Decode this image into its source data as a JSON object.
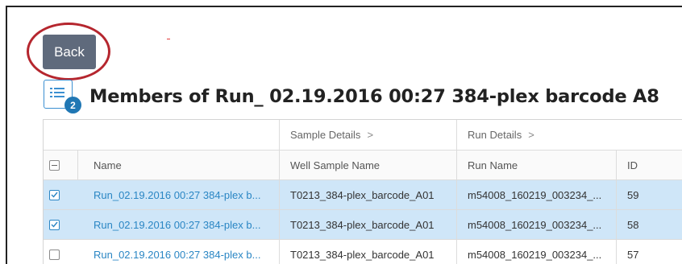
{
  "back_button": {
    "label": "Back"
  },
  "list_button": {
    "icon": "list-icon",
    "badge_count": "2"
  },
  "page_title": "Members of Run_ 02.19.2016 00:27 384-plex barcode A8",
  "table": {
    "column_groups": [
      {
        "label": "Sample Details",
        "chevron": ">"
      },
      {
        "label": "Run Details",
        "chevron": ">"
      }
    ],
    "columns": {
      "name": "Name",
      "well_sample_name": "Well Sample Name",
      "run_name": "Run Name",
      "id": "ID"
    },
    "rows": [
      {
        "selected": true,
        "name": "Run_02.19.2016 00:27 384-plex b...",
        "well_sample_name": "T0213_384-plex_barcode_A01",
        "run_name": "m54008_160219_003234_...",
        "id": "59"
      },
      {
        "selected": true,
        "name": "Run_02.19.2016 00:27 384-plex b...",
        "well_sample_name": "T0213_384-plex_barcode_A01",
        "run_name": "m54008_160219_003234_...",
        "id": "58"
      },
      {
        "selected": false,
        "name": "Run_02.19.2016 00:27 384-plex b...",
        "well_sample_name": "T0213_384-plex_barcode_A01",
        "run_name": "m54008_160219_003234_...",
        "id": "57"
      }
    ]
  },
  "colors": {
    "back_button_bg": "#5f6a7c",
    "highlight_ring": "#b5262e",
    "selected_row_bg": "#cfe6f8",
    "link": "#2a86c4",
    "badge": "#2077b4"
  }
}
